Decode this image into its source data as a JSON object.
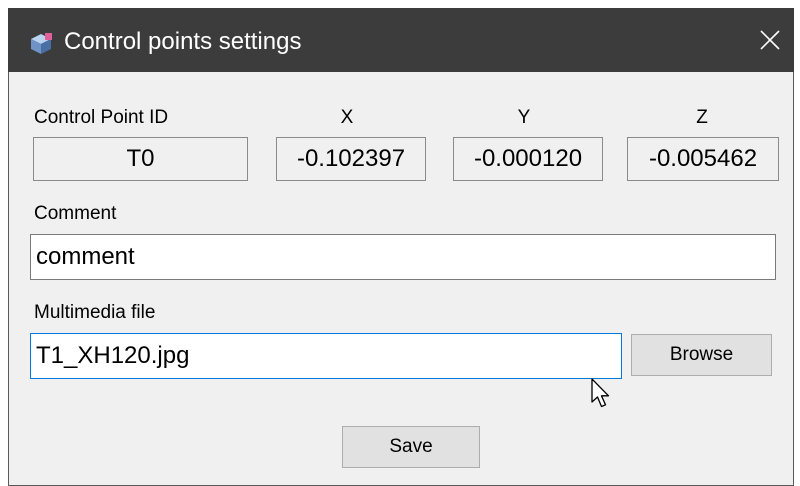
{
  "window": {
    "title": "Control points settings",
    "app_icon": "app-cube-icon",
    "close_icon": "close-icon"
  },
  "point": {
    "id_label": "Control Point ID",
    "id_value": "T0",
    "x_label": "X",
    "x_value": "-0.102397",
    "y_label": "Y",
    "y_value": "-0.000120",
    "z_label": "Z",
    "z_value": "-0.005462"
  },
  "comment": {
    "label": "Comment",
    "value": "comment"
  },
  "multimedia": {
    "label": "Multimedia file",
    "value": "T1_XH120.jpg",
    "browse_label": "Browse"
  },
  "actions": {
    "save_label": "Save"
  },
  "colors": {
    "titlebar": "#3c3c3c",
    "dialog_bg": "#f0f0f0",
    "focus_border": "#0078d7",
    "button_bg": "#e1e1e1"
  }
}
